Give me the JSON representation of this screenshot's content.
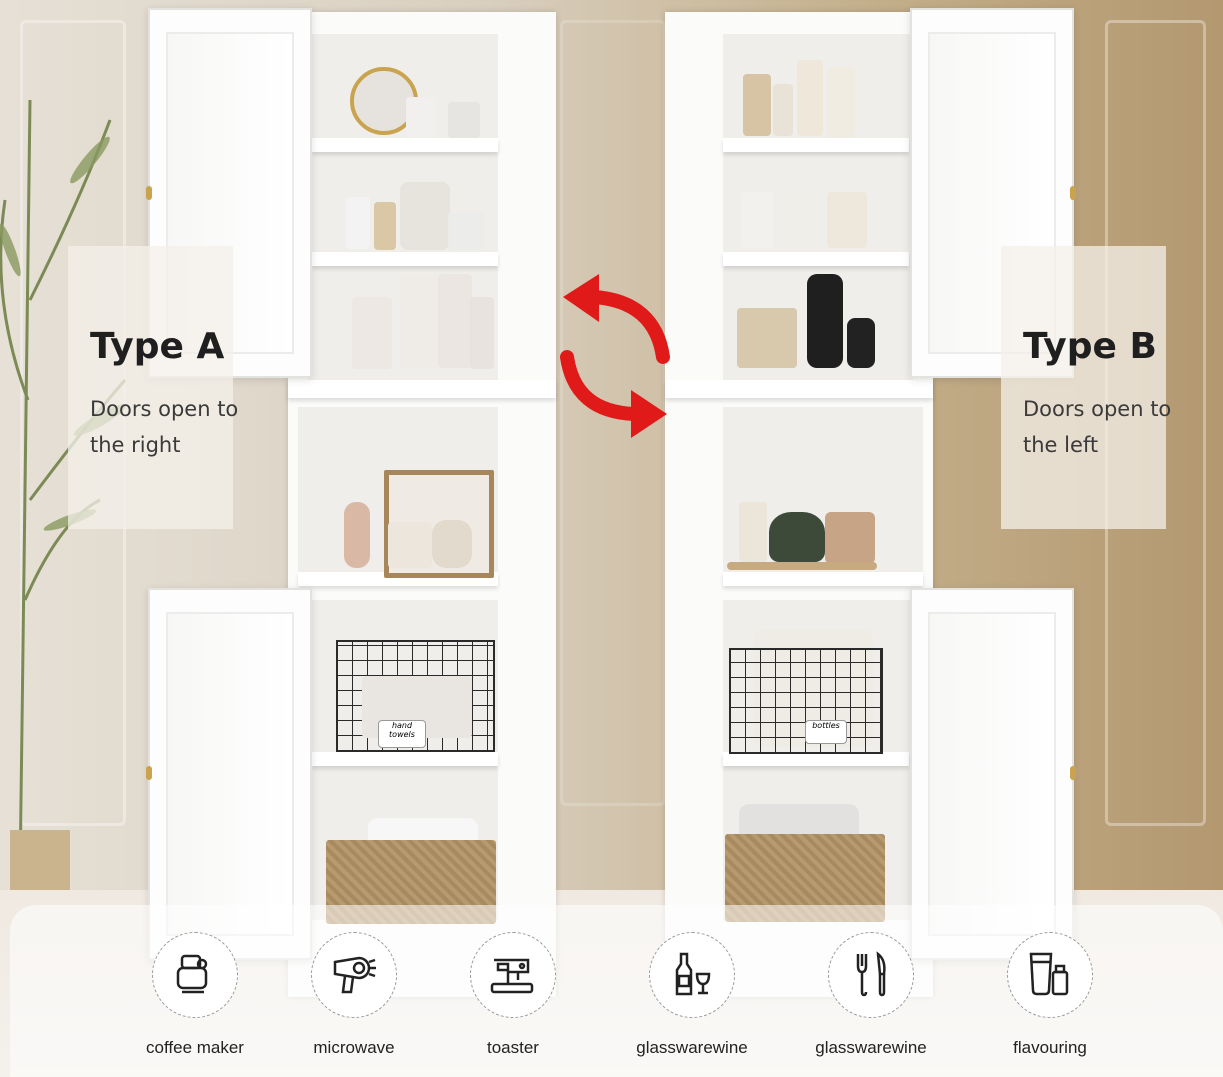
{
  "type_a": {
    "title": "Type A",
    "description": "Doors open to the right"
  },
  "type_b": {
    "title": "Type B",
    "description": "Doors open to the left"
  },
  "basket_tags": {
    "left": "hand towels",
    "right": "bottles"
  },
  "features": [
    {
      "label": "coffee maker",
      "icon": "coffee-maker-icon"
    },
    {
      "label": "microwave",
      "icon": "hair-dryer-icon"
    },
    {
      "label": "toaster",
      "icon": "sewing-machine-icon"
    },
    {
      "label": "glasswarewine",
      "icon": "wine-glass-icon"
    },
    {
      "label": "glasswarewine",
      "icon": "cutlery-icon"
    },
    {
      "label": "flavouring",
      "icon": "bottles-icon"
    }
  ],
  "colors": {
    "arrow": "#e01919",
    "cabinet": "#fbfbfa",
    "knob": "#c9a34e"
  }
}
